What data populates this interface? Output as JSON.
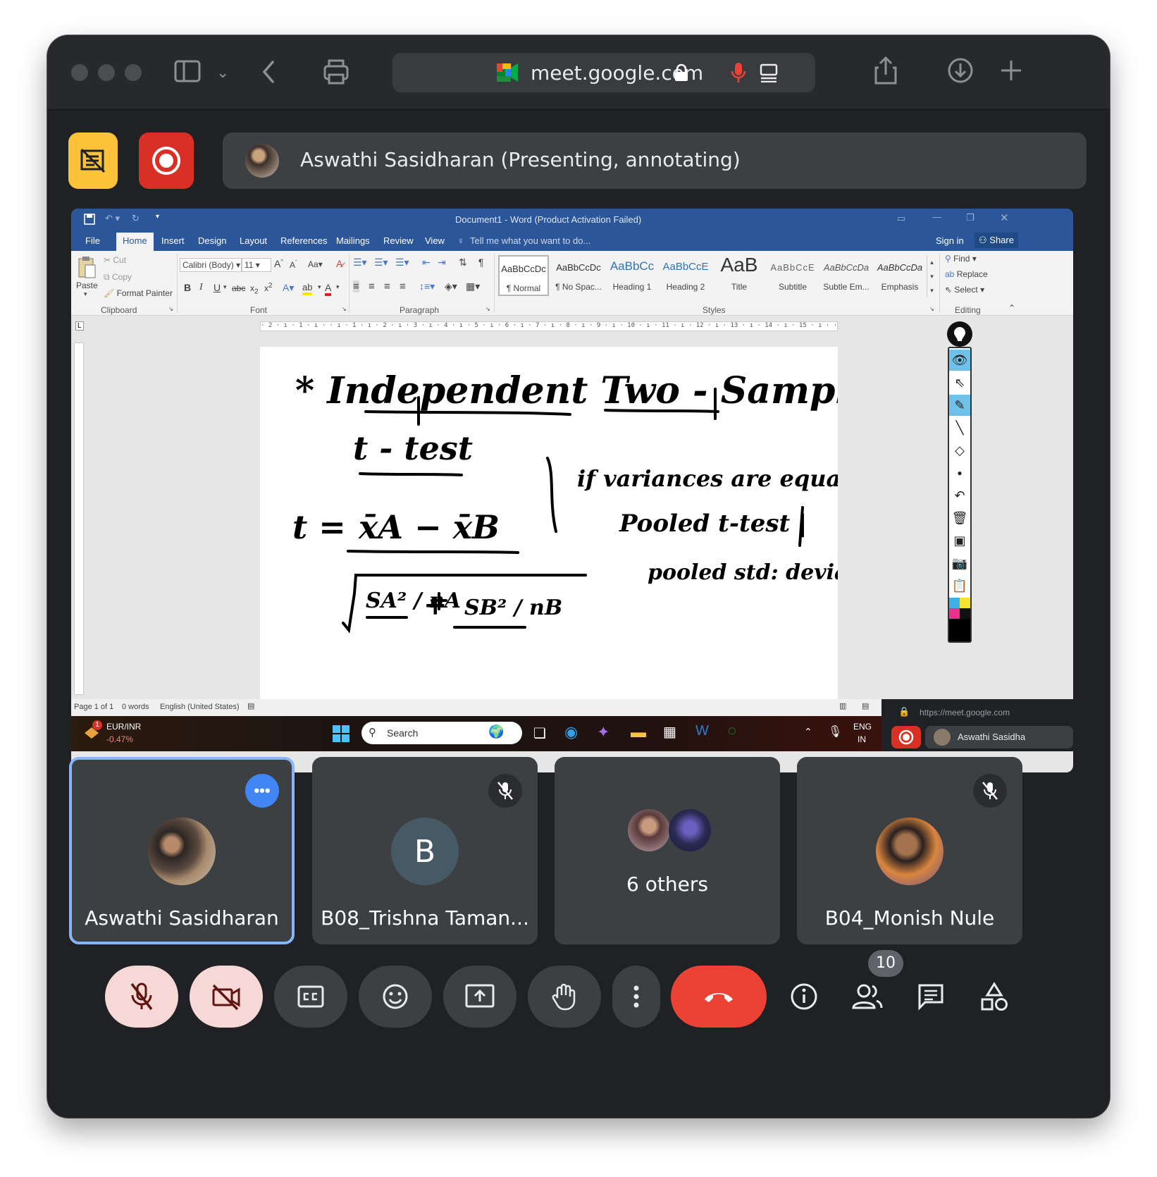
{
  "browser": {
    "url": "meet.google.com"
  },
  "meet": {
    "presenter_label": "Aswathi Sasidharan (Presenting, annotating)",
    "participants_count": "10"
  },
  "word": {
    "title": "Document1 - Word (Product Activation Failed)",
    "tabs": [
      "File",
      "Home",
      "Insert",
      "Design",
      "Layout",
      "References",
      "Mailings",
      "Review",
      "View"
    ],
    "tell_me": "Tell me what you want to do...",
    "sign_in": "Sign in",
    "share": "Share",
    "clipboard": {
      "paste": "Paste",
      "cut": "Cut",
      "copy": "Copy",
      "format_painter": "Format Painter",
      "label": "Clipboard"
    },
    "font": {
      "name": "Calibri (Body)",
      "size": "11",
      "label": "Font",
      "aa": "Aa"
    },
    "paragraph_label": "Paragraph",
    "styles": [
      {
        "preview": "AaBbCcDc",
        "name": "¶ Normal"
      },
      {
        "preview": "AaBbCcDc",
        "name": "¶ No Spac..."
      },
      {
        "preview": "AaBbCc",
        "name": "Heading 1"
      },
      {
        "preview": "AaBbCcE",
        "name": "Heading 2"
      },
      {
        "preview": "AaB",
        "name": "Title"
      },
      {
        "preview": "AaBbCcE",
        "name": "Subtitle"
      },
      {
        "preview": "AaBbCcDa",
        "name": "Subtle Em..."
      },
      {
        "preview": "AaBbCcDa",
        "name": "Emphasis"
      }
    ],
    "styles_label": "Styles",
    "editing": {
      "find": "Find",
      "replace": "Replace",
      "select": "Select",
      "label": "Editing"
    },
    "ruler_text": "· 2 · ı · 1 · ı ·   · ı · 1 · ı · 2 · ı · 3 · ı · 4 · ı · 5 · ı · 6 · ı · 7 · ı · 8 · ı · 9 · ı · 10 · ı · 11 · ı · 12 · ı · 13 · ı · 14 · ı · 15 · ı ·   · ı · 17 · ı · 18 ·",
    "status": {
      "page": "Page 1 of 1",
      "words": "0 words",
      "language": "English (United States)"
    }
  },
  "handwriting": {
    "title_line": "* Independent Two - Sample",
    "subtitle": "t - test",
    "note1": "if variances are equal |",
    "note2": "Pooled t-test |",
    "note3": "pooled std: deviation",
    "formula_t": "t =",
    "numerator": "x̄A − x̄B",
    "den_a": "SA² / nA",
    "plus": "+",
    "den_b": "SB² / nB"
  },
  "taskbar": {
    "ticker_name": "EUR/INR",
    "ticker_change": "-0.47%",
    "ticker_badge": "1",
    "search": "Search",
    "lang1": "ENG",
    "lang2": "IN"
  },
  "meet_mini": {
    "url": "https://meet.google.com",
    "name": "Aswathi Sasidha"
  },
  "tiles": [
    {
      "name": "Aswathi Sasidharan",
      "initial": ""
    },
    {
      "name": "B08_Trishna Taman...",
      "initial": "B"
    },
    {
      "name": "6 others",
      "initial": ""
    },
    {
      "name": "B04_Monish Nule",
      "initial": ""
    }
  ],
  "colors": {
    "word_blue": "#2b579a",
    "meet_bg": "#202124",
    "tile_bg": "#3c4043",
    "end_call": "#ea4335",
    "yellow_btn": "#fbbc04",
    "record_btn": "#ea4335",
    "active_border": "#8ab4f8"
  }
}
